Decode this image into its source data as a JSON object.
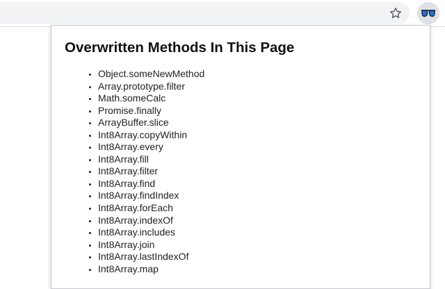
{
  "browser": {
    "bookmark_icon": "star-outline-icon",
    "extension_icon": "glasses-icon",
    "extension_colors": {
      "lens": "#1a73e8",
      "frame": "#202124"
    }
  },
  "popup": {
    "title": "Overwritten Methods In This Page",
    "methods": [
      "Object.someNewMethod",
      "Array.prototype.filter",
      "Math.someCalc",
      "Promise.finally",
      "ArrayBuffer.slice",
      "Int8Array.copyWithin",
      "Int8Array.every",
      "Int8Array.fill",
      "Int8Array.filter",
      "Int8Array.find",
      "Int8Array.findIndex",
      "Int8Array.forEach",
      "Int8Array.indexOf",
      "Int8Array.includes",
      "Int8Array.join",
      "Int8Array.lastIndexOf",
      "Int8Array.map"
    ]
  }
}
